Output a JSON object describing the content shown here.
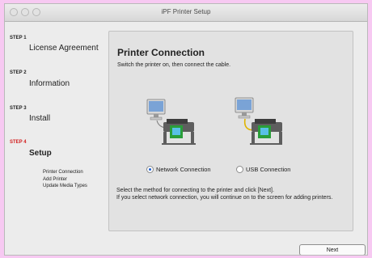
{
  "window": {
    "title": "iPF Printer Setup"
  },
  "sidebar": {
    "steps": [
      {
        "num": "STEP 1",
        "title": "License Agreement"
      },
      {
        "num": "STEP 2",
        "title": "Information"
      },
      {
        "num": "STEP 3",
        "title": "Install"
      },
      {
        "num": "STEP 4",
        "title": "Setup"
      }
    ],
    "sub_items": [
      "Printer Connection",
      "Add Printer",
      "Update Media Types"
    ]
  },
  "panel": {
    "title": "Printer Connection",
    "subtitle": "Switch the printer on, then connect the cable.",
    "options": [
      {
        "label": "Network Connection",
        "selected": true
      },
      {
        "label": "USB Connection",
        "selected": false
      }
    ],
    "instructions": [
      "Select the method for connecting to the printer and click [Next].",
      "If you select network connection, you will continue on to the screen for adding printers."
    ]
  },
  "footer": {
    "next_label": "Next"
  },
  "colors": {
    "active_step": "#d21e1e",
    "radio_selected": "#1e5fd1",
    "background": "#f7c9f2"
  }
}
